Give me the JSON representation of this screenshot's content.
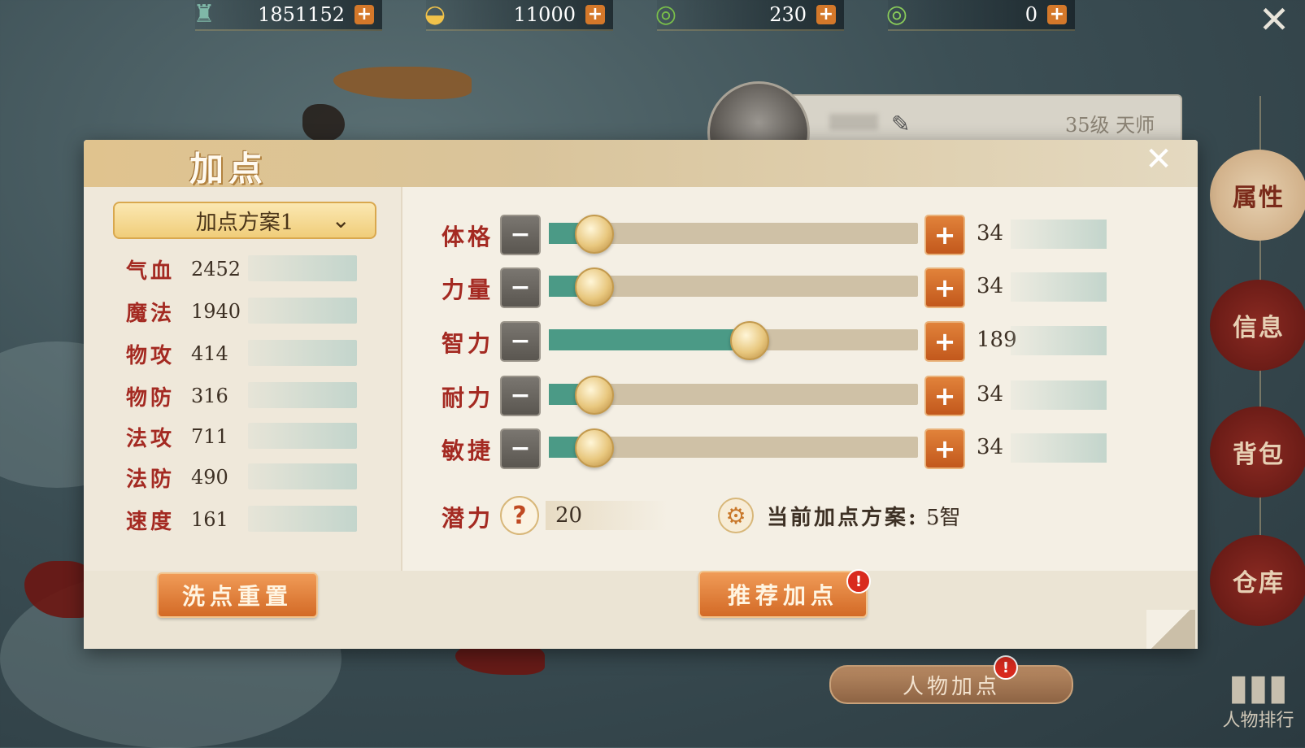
{
  "currency": [
    {
      "icon": "tower-icon",
      "value": "1851152"
    },
    {
      "icon": "gold-ingot-icon",
      "value": "11000"
    },
    {
      "icon": "jade-dragon-red-icon",
      "value": "230"
    },
    {
      "icon": "jade-dragon-green-icon",
      "value": "0"
    }
  ],
  "plus_symbol": "+",
  "close_symbol": "✕",
  "character": {
    "level_label": "35级 天师"
  },
  "panel": {
    "title": "加点",
    "scheme_dropdown": "加点方案1",
    "stats": [
      {
        "label": "气血",
        "value": "2452"
      },
      {
        "label": "魔法",
        "value": "1940"
      },
      {
        "label": "物攻",
        "value": "414"
      },
      {
        "label": "物防",
        "value": "316"
      },
      {
        "label": "法攻",
        "value": "711"
      },
      {
        "label": "法防",
        "value": "490"
      },
      {
        "label": "速度",
        "value": "161"
      }
    ],
    "attributes": [
      {
        "label": "体格",
        "value": "34",
        "level": 0.12
      },
      {
        "label": "力量",
        "value": "34",
        "level": 0.12
      },
      {
        "label": "智力",
        "value": "189",
        "level": 0.54
      },
      {
        "label": "耐力",
        "value": "34",
        "level": 0.12
      },
      {
        "label": "敏捷",
        "value": "34",
        "level": 0.12
      }
    ],
    "potential_label": "潜力",
    "potential_value": "20",
    "help_symbol": "?",
    "current_scheme_label": "当前加点方案:",
    "current_scheme_value": "5智",
    "reset_button": "洗点重置",
    "recommend_button": "推荐加点",
    "alert_symbol": "!"
  },
  "side_nav": [
    "属性",
    "信息",
    "背包",
    "仓库"
  ],
  "rank_button": "人物排行",
  "char_addpt_button": "人物加点",
  "colors": {
    "accent_red": "#a42a22",
    "slider_fill": "#4b9a86",
    "button_orange": "#d36a26"
  }
}
